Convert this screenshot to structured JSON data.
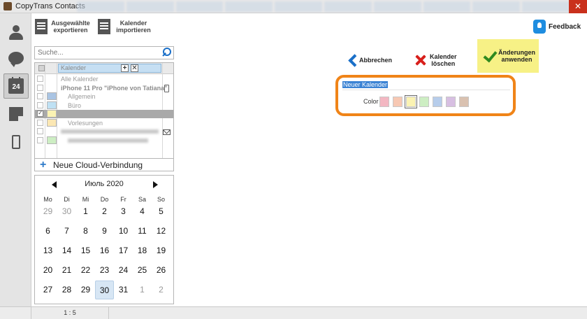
{
  "window": {
    "title": "CopyTrans Contacts",
    "close_glyph": "✕"
  },
  "rail": [
    "person-icon",
    "chat-bubble-icon",
    "calendar-icon",
    "note-icon",
    "phone-icon"
  ],
  "rail_calendar_day": "24",
  "toolbar": {
    "export_label": "Ausgewählte\nexportieren",
    "import_label": "Kalender\nimportieren",
    "feedback_label": "Feedback"
  },
  "search": {
    "placeholder": "Suche..."
  },
  "calendar_list": {
    "header_name": "Kalender",
    "header_add": "+",
    "header_remove": "✕",
    "rows": [
      {
        "name": "Alle Kalender",
        "color": "",
        "checked": false,
        "style": "group"
      },
      {
        "name": "iPhone 11 Pro \"iPhone von Tatiana\"",
        "color": "",
        "checked": false,
        "style": "device"
      },
      {
        "name": "Allgemein",
        "color": "#a9c4e3",
        "checked": false,
        "style": "child"
      },
      {
        "name": "Büro",
        "color": "#bfe1f4",
        "checked": false,
        "style": "child"
      },
      {
        "name": "",
        "color": "#fbf3b3",
        "checked": true,
        "style": "selected"
      },
      {
        "name": "Vorlesungen",
        "color": "#fbe7b3",
        "checked": false,
        "style": "child"
      },
      {
        "name": "",
        "color": "",
        "checked": false,
        "style": "account"
      },
      {
        "name": "",
        "color": "#cdeec3",
        "checked": false,
        "style": "account-child"
      }
    ]
  },
  "cloud_button": {
    "plus": "+",
    "label": "Neue Cloud-Verbindung"
  },
  "month_calendar": {
    "title": "Июль 2020",
    "weekdays": [
      "Mo",
      "Di",
      "Mi",
      "Do",
      "Fr",
      "Sa",
      "So"
    ],
    "weeks": [
      [
        "29",
        "30",
        "1",
        "2",
        "3",
        "4",
        "5"
      ],
      [
        "6",
        "7",
        "8",
        "9",
        "10",
        "11",
        "12"
      ],
      [
        "13",
        "14",
        "15",
        "16",
        "17",
        "18",
        "19"
      ],
      [
        "20",
        "21",
        "22",
        "23",
        "24",
        "25",
        "26"
      ],
      [
        "27",
        "28",
        "29",
        "30",
        "31",
        "1",
        "2"
      ]
    ],
    "dim_cells": [
      [
        0,
        0
      ],
      [
        0,
        1
      ],
      [
        4,
        5
      ],
      [
        4,
        6
      ]
    ],
    "today_cell": [
      4,
      3
    ]
  },
  "actions": {
    "cancel_label": "Abbrechen",
    "delete_label": "Kalender\nlöschen",
    "apply_label": "Änderungen\nanwenden",
    "apply_bg": "#f7f186"
  },
  "editor": {
    "name_value": "Neuer Kalender",
    "color_label": "Color",
    "swatches": [
      "#f3b7c2",
      "#f7c8b3",
      "#fbf3b3",
      "#cdeec3",
      "#b7cdeb",
      "#d7bfe2",
      "#d9c1b0"
    ],
    "selected_swatch": 2,
    "highlight_color": "#f08418"
  },
  "status": {
    "ratio": "1 : 5"
  }
}
